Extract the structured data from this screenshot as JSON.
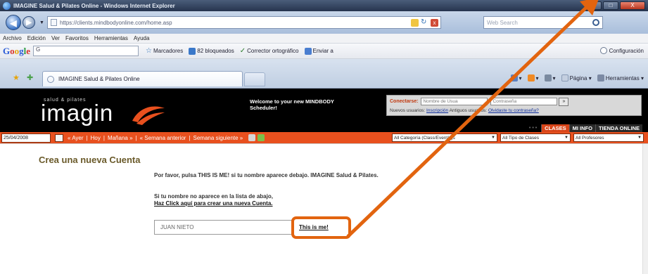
{
  "window": {
    "title": "IMAGINE Salud & Pilates Online - Windows Internet Explorer",
    "minimize": "–",
    "maximize": "□",
    "close": "X"
  },
  "address": {
    "url": "https://clients.mindbodyonline.com/home.asp",
    "search_placeholder": "Web Search"
  },
  "menu": [
    "Archivo",
    "Edición",
    "Ver",
    "Favoritos",
    "Herramientas",
    "Ayuda"
  ],
  "google_toolbar": {
    "logo": [
      "G",
      "o",
      "o",
      "g",
      "l",
      "e"
    ],
    "search_value": "G",
    "bookmarks": "Marcadores",
    "blocked": "82 bloqueados",
    "spellcheck": "Corrector ortográfico",
    "send": "Enviar a",
    "settings": "Configuración"
  },
  "tab": {
    "active_label": "IMAGINE Salud & Pilates Online"
  },
  "command_bar": {
    "page": "Página",
    "tools": "Herramientas"
  },
  "site": {
    "logo_sub": "salud & pilates",
    "logo_text": "imagin",
    "welcome": "Welcome to your new MINDBODY Scheduler!",
    "login_label": "Conectarse:",
    "username_placeholder": "Nombre de Usua",
    "password_placeholder": "Contraseña",
    "go_label": "»",
    "new_users_text": "Nuevos usuarios:",
    "register_link": "Inscripción",
    "old_users_text": "Antiguos usuarios:",
    "forgot_link": "Olvidaste tu contraseña?",
    "tabs": [
      {
        "label": "CLASES",
        "active": true
      },
      {
        "label": "MI INFO",
        "active": false
      },
      {
        "label": "TIENDA ONLINE",
        "active": false
      }
    ],
    "date_value": "25/04/2008",
    "date_nav": [
      "« Ayer",
      "|",
      "Hoy",
      "|",
      "Mañana »",
      "|",
      "« Semana anterior",
      "|",
      "Semana siguiente »"
    ],
    "filters": [
      "All Categoría (Class/Event/x)s",
      "All Tipo de Clases",
      "All Profesores"
    ]
  },
  "content": {
    "title": "Crea una nueva Cuenta",
    "instruction": "Por favor, pulsa THIS IS ME! si tu nombre aparece debajo. IMAGINE Salud & Pilates.",
    "not_found": "Si tu nombre no aparece en la lista de abajo,",
    "create_link": "Haz Click aquí para crear una nueva Cuenta.",
    "name_value": "JUAN NIETO",
    "this_is_me": "This is me!"
  },
  "annotation": {
    "color": "#e2640f"
  }
}
